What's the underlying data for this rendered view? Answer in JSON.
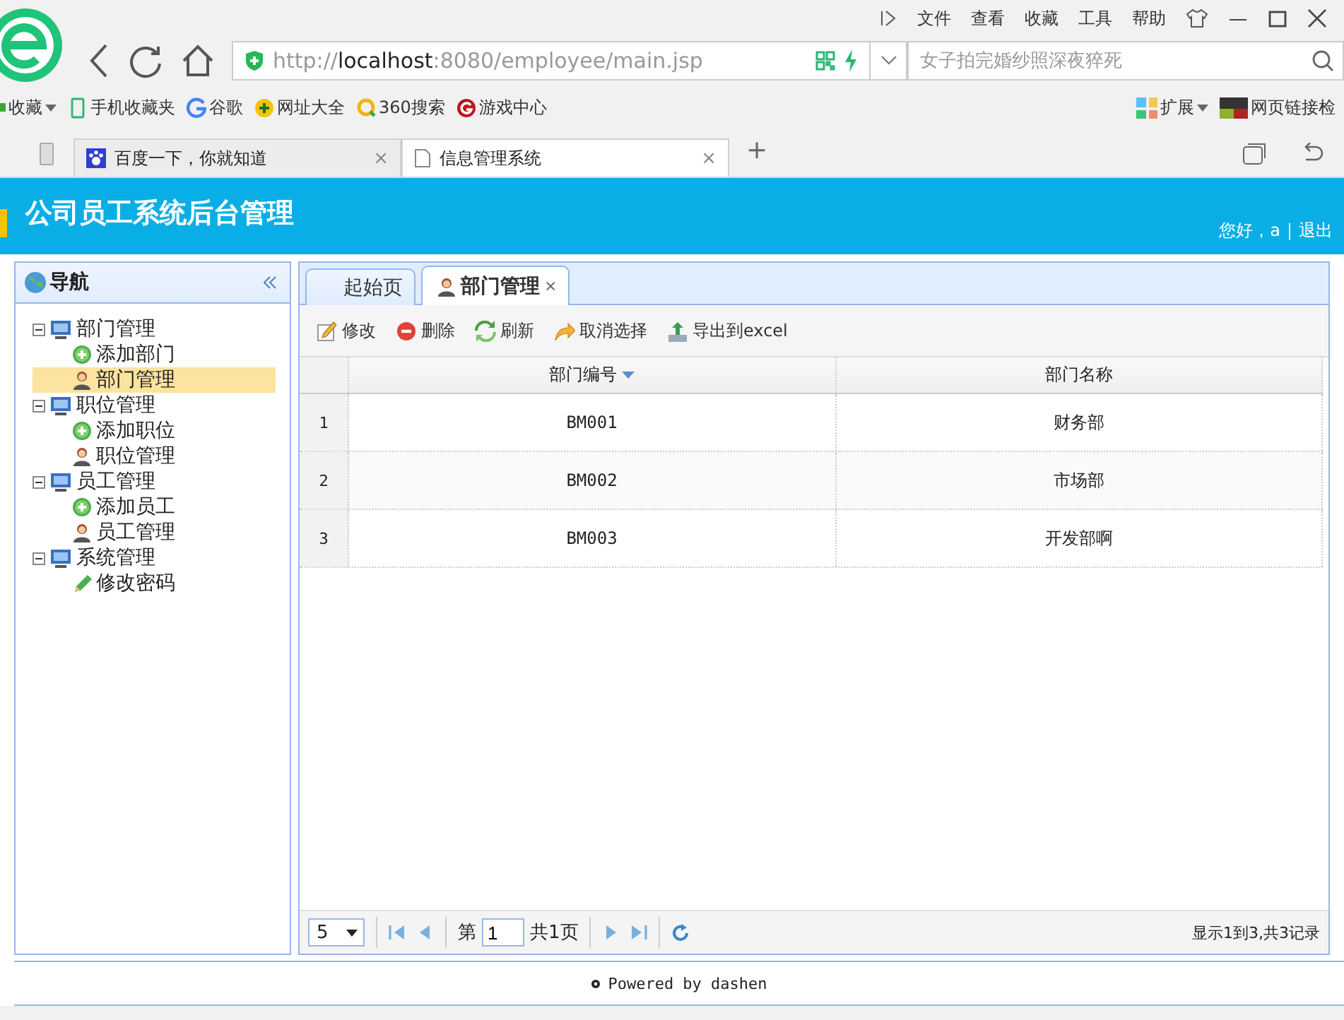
{
  "browser": {
    "menu": [
      "文件",
      "查看",
      "收藏",
      "工具",
      "帮助"
    ],
    "url": {
      "scheme": "http://",
      "host": "localhost",
      "rest": ":8080/employee/main.jsp"
    },
    "search": {
      "placeholder": "女子拍完婚纱照深夜猝死"
    },
    "bookmarks": [
      {
        "label": "收藏",
        "kind": "favorites"
      },
      {
        "label": "手机收藏夹",
        "kind": "phone"
      },
      {
        "label": "谷歌",
        "kind": "google"
      },
      {
        "label": "网址大全",
        "kind": "plus"
      },
      {
        "label": "360搜索",
        "kind": "ring"
      },
      {
        "label": "游戏中心",
        "kind": "game"
      }
    ],
    "extensions": [
      {
        "label": "扩展",
        "kind": "grid"
      },
      {
        "label": "网页链接检",
        "kind": "tile"
      }
    ],
    "tabs": [
      {
        "title": "百度一下，你就知道",
        "kind": "paw",
        "selected": false,
        "close": "×"
      },
      {
        "title": "信息管理系统",
        "kind": "page",
        "selected": true,
        "close": "×"
      }
    ],
    "new_tab": "+"
  },
  "app": {
    "title": "公司员工系统后台管理",
    "greeting": "您好，a",
    "logout": "退出"
  },
  "nav": {
    "title": "导航",
    "tree": [
      {
        "label": "部门管理",
        "expanded": true,
        "children": [
          {
            "label": "添加部门",
            "kind": "add",
            "selected": false
          },
          {
            "label": "部门管理",
            "kind": "person",
            "selected": true
          }
        ]
      },
      {
        "label": "职位管理",
        "expanded": true,
        "children": [
          {
            "label": "添加职位",
            "kind": "add",
            "selected": false
          },
          {
            "label": "职位管理",
            "kind": "person",
            "selected": false
          }
        ]
      },
      {
        "label": "员工管理",
        "expanded": true,
        "children": [
          {
            "label": "添加员工",
            "kind": "add",
            "selected": false
          },
          {
            "label": "员工管理",
            "kind": "person",
            "selected": false
          }
        ]
      },
      {
        "label": "系统管理",
        "expanded": true,
        "children": [
          {
            "label": "修改密码",
            "kind": "pencil",
            "selected": false
          }
        ]
      }
    ]
  },
  "content": {
    "tabs": [
      {
        "label": "起始页",
        "selected": false
      },
      {
        "label": "部门管理",
        "selected": true,
        "close": "×"
      }
    ],
    "toolbar": [
      {
        "label": "修改",
        "kind": "edit"
      },
      {
        "label": "删除",
        "kind": "delete"
      },
      {
        "label": "刷新",
        "kind": "refresh"
      },
      {
        "label": "取消选择",
        "kind": "undo"
      },
      {
        "label": "导出到excel",
        "kind": "export"
      }
    ],
    "table": {
      "columns": [
        {
          "label": "部门编号",
          "sorted": true
        },
        {
          "label": "部门名称",
          "sorted": false
        }
      ],
      "rows": [
        {
          "number": "1",
          "cells": [
            "BM001",
            "财务部"
          ]
        },
        {
          "number": "2",
          "cells": [
            "BM002",
            "市场部"
          ]
        },
        {
          "number": "3",
          "cells": [
            "BM003",
            "开发部啊"
          ]
        }
      ]
    },
    "pager": {
      "page_size": "5",
      "page_label": "第",
      "page": "1",
      "total": "共1页",
      "summary": "显示1到3,共3记录"
    }
  },
  "footer": "Powered by dashen"
}
